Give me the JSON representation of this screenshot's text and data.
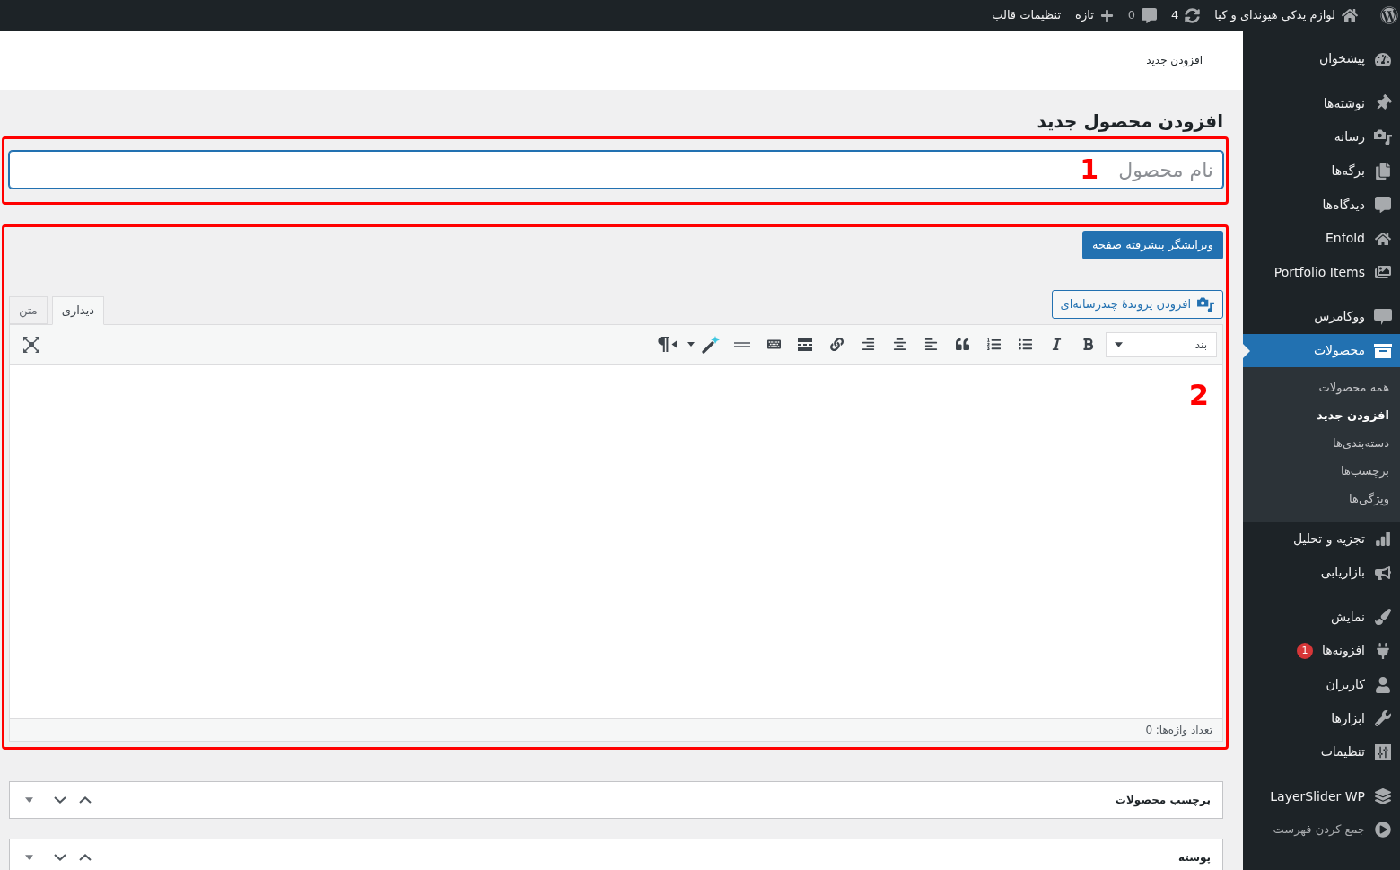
{
  "admin_bar": {
    "items": [
      {
        "label": "لوازم یدکی هیوندای و کیا"
      },
      {
        "label": "4"
      },
      {
        "label": "0"
      },
      {
        "label": "تازه"
      },
      {
        "label": "تنظیمات قالب"
      }
    ]
  },
  "sidebar": {
    "sections": [
      {
        "items": [
          {
            "label": "پیشخوان",
            "selected": false
          }
        ]
      },
      {
        "items": [
          {
            "label": "نوشته‌ها",
            "selected": false
          },
          {
            "label": "رسانه",
            "selected": false
          },
          {
            "label": "برگه‌ها",
            "selected": false
          },
          {
            "label": "دیدگاه‌ها",
            "selected": false
          },
          {
            "label": "Enfold",
            "selected": false
          },
          {
            "label": "Portfolio Items",
            "selected": false
          }
        ]
      },
      {
        "items": [
          {
            "label": "ووکامرس",
            "selected": false
          },
          {
            "label": "محصولات",
            "selected": true,
            "children": [
              {
                "label": "همه محصولات",
                "selected": false
              },
              {
                "label": "افزودن جدید",
                "selected": true
              },
              {
                "label": "دسته‌بندی‌ها",
                "selected": false
              },
              {
                "label": "برچسب‌ها",
                "selected": false
              },
              {
                "label": "ویژگی‌ها",
                "selected": false
              }
            ]
          },
          {
            "label": "تجزیه و تحلیل",
            "selected": false
          },
          {
            "label": "بازاریابی",
            "selected": false
          }
        ]
      },
      {
        "items": [
          {
            "label": "نمایش",
            "selected": false
          },
          {
            "label": "افزونه‌ها",
            "selected": false,
            "badge": "1"
          },
          {
            "label": "کاربران",
            "selected": false
          },
          {
            "label": "ابزارها",
            "selected": false
          },
          {
            "label": "تنظیمات",
            "selected": false
          }
        ]
      },
      {
        "items": [
          {
            "label": "LayerSlider WP",
            "selected": false
          }
        ]
      }
    ],
    "collapse": {
      "label": "جمع کردن فهرست"
    }
  },
  "screen_header": {
    "title": "افزودن جدید"
  },
  "heading": "افزودن محصول جدید",
  "title_field": {
    "placeholder": "نام محصول",
    "focused": true
  },
  "editor": {
    "builder_button": "ویرایشگر پیشرفته صفحه",
    "media_button": "افزودن پروندهٔ چندرسانه‌ای",
    "tabs": [
      {
        "label": "دیداری",
        "selected": true
      },
      {
        "label": "متن",
        "selected": false
      }
    ],
    "format_select": {
      "value": "بند"
    },
    "word_count": "تعداد واژه‌ها: 0"
  },
  "annotations": [
    {
      "number": "1"
    },
    {
      "number": "2"
    }
  ],
  "postboxes": [
    {
      "title": "برچسب محصولات"
    },
    {
      "title": "پوسته"
    }
  ]
}
